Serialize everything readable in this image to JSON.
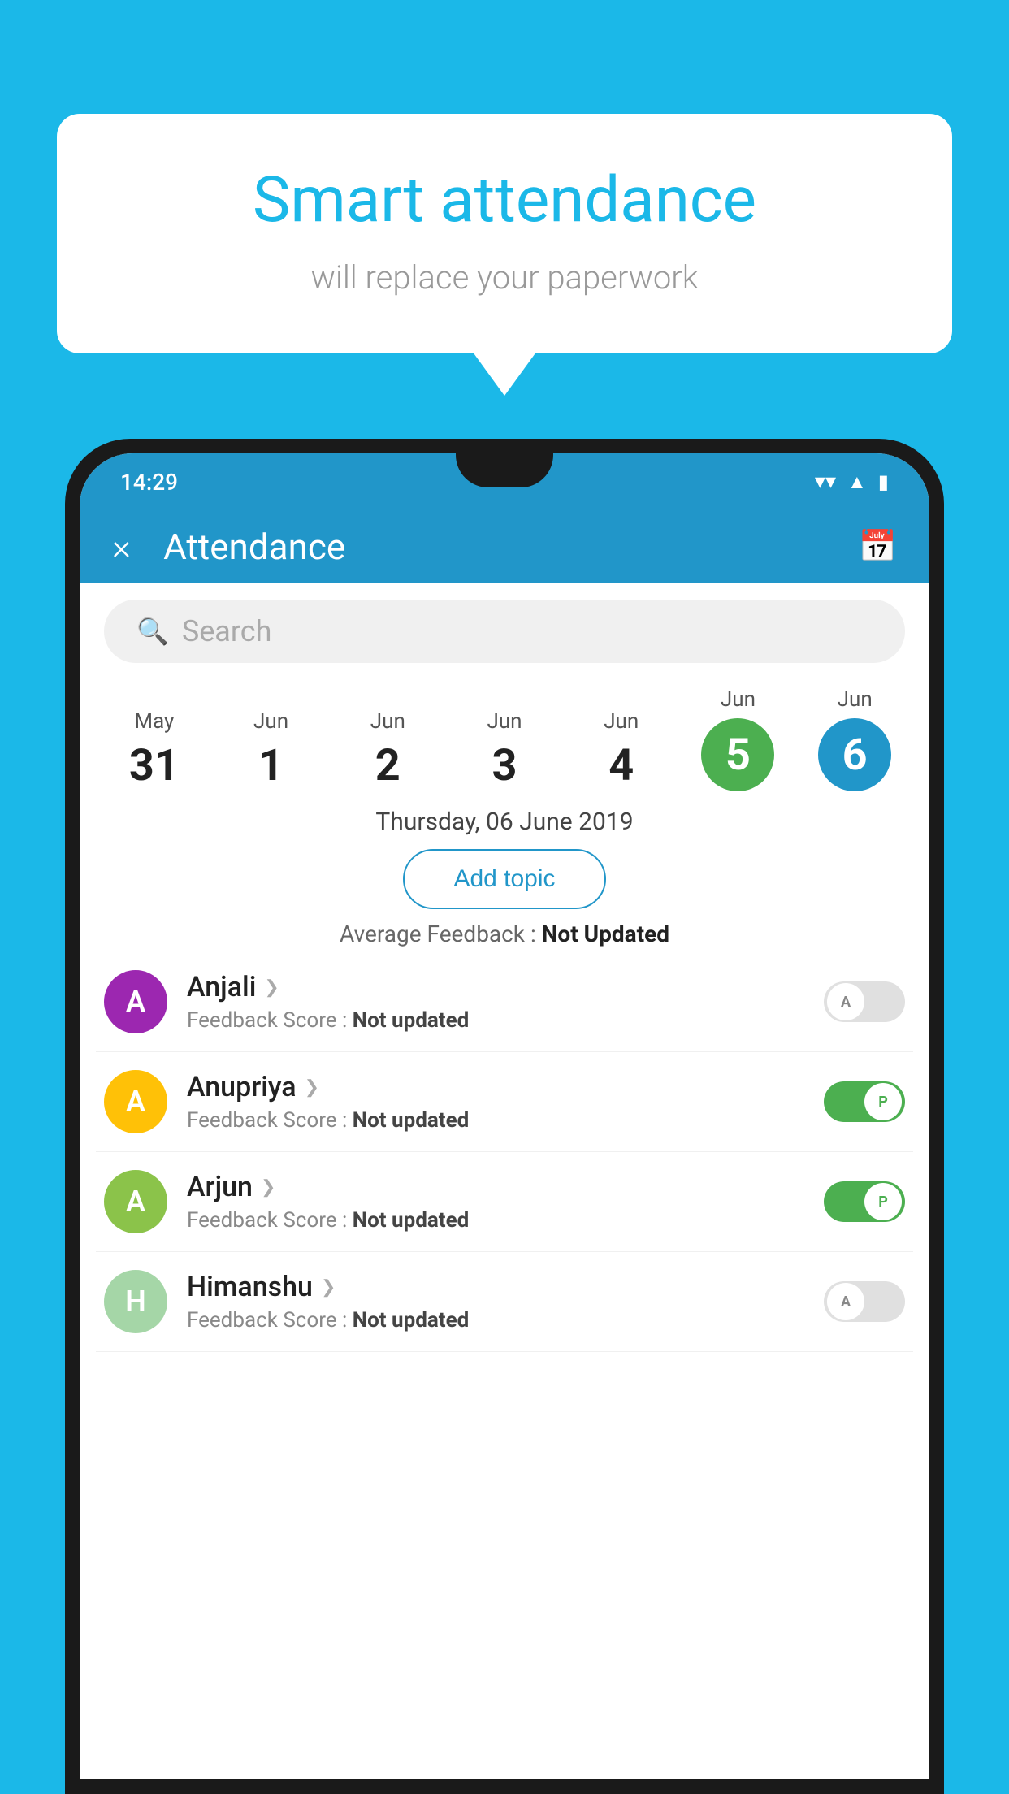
{
  "background_color": "#1BB8E8",
  "speech_bubble": {
    "title": "Smart attendance",
    "subtitle": "will replace your paperwork"
  },
  "status_bar": {
    "time": "14:29",
    "icons": [
      "wifi",
      "signal",
      "battery"
    ]
  },
  "header": {
    "title": "Attendance",
    "close_label": "×",
    "calendar_icon": "📅"
  },
  "search": {
    "placeholder": "Search"
  },
  "calendar": {
    "dates": [
      {
        "month": "May",
        "day": "31"
      },
      {
        "month": "Jun",
        "day": "1"
      },
      {
        "month": "Jun",
        "day": "2"
      },
      {
        "month": "Jun",
        "day": "3"
      },
      {
        "month": "Jun",
        "day": "4"
      },
      {
        "month": "Jun",
        "day": "5",
        "highlight": "green"
      },
      {
        "month": "Jun",
        "day": "6",
        "highlight": "blue"
      }
    ]
  },
  "selected_date": "Thursday, 06 June 2019",
  "add_topic_label": "Add topic",
  "avg_feedback_label": "Average Feedback : ",
  "avg_feedback_value": "Not Updated",
  "students": [
    {
      "name": "Anjali",
      "initial": "A",
      "avatar_color": "#9C27B0",
      "feedback_label": "Feedback Score : ",
      "feedback_value": "Not updated",
      "toggle": "off",
      "toggle_letter": "A"
    },
    {
      "name": "Anupriya",
      "initial": "A",
      "avatar_color": "#FFC107",
      "feedback_label": "Feedback Score : ",
      "feedback_value": "Not updated",
      "toggle": "on",
      "toggle_letter": "P"
    },
    {
      "name": "Arjun",
      "initial": "A",
      "avatar_color": "#8BC34A",
      "feedback_label": "Feedback Score : ",
      "feedback_value": "Not updated",
      "toggle": "on",
      "toggle_letter": "P"
    },
    {
      "name": "Himanshu",
      "initial": "H",
      "avatar_color": "#A5D6A7",
      "feedback_label": "Feedback Score : ",
      "feedback_value": "Not updated",
      "toggle": "off",
      "toggle_letter": "A"
    }
  ]
}
